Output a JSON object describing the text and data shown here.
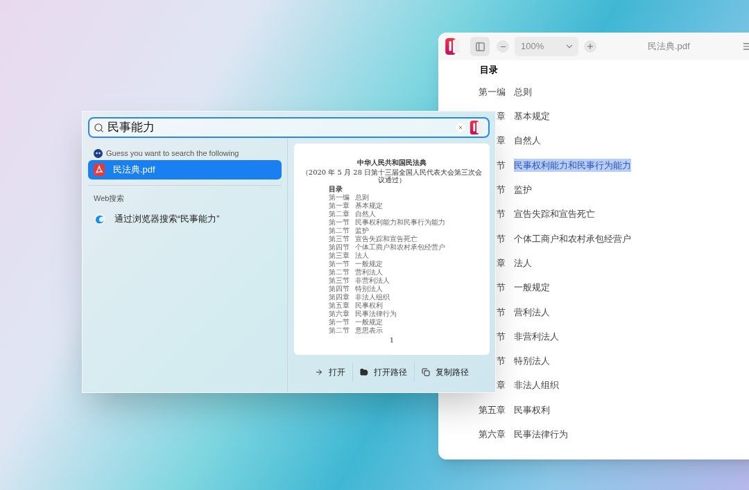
{
  "reader": {
    "title": "民法典.pdf",
    "zoom": "100%",
    "heading": "目录",
    "rows": [
      {
        "label": "第一编",
        "text": "总则",
        "highlighted": false
      },
      {
        "label": "章",
        "text": "基本规定",
        "highlighted": false
      },
      {
        "label": "章",
        "text": "自然人",
        "highlighted": false
      },
      {
        "label": "节",
        "text": "民事权利能力和民事行为能力",
        "highlighted": true
      },
      {
        "label": "节",
        "text": "监护",
        "highlighted": false
      },
      {
        "label": "节",
        "text": "宣告失踪和宣告死亡",
        "highlighted": false
      },
      {
        "label": "节",
        "text": "个体工商户和农村承包经营户",
        "highlighted": false
      },
      {
        "label": "章",
        "text": "法人",
        "highlighted": false
      },
      {
        "label": "节",
        "text": "一般规定",
        "highlighted": false
      },
      {
        "label": "节",
        "text": "营利法人",
        "highlighted": false
      },
      {
        "label": "节",
        "text": "非营利法人",
        "highlighted": false
      },
      {
        "label": "节",
        "text": "特别法人",
        "highlighted": false
      },
      {
        "label": "章",
        "text": "非法人组织",
        "highlighted": false
      },
      {
        "label": "第五章",
        "text": "民事权利",
        "highlighted": false
      },
      {
        "label": "第六章",
        "text": "民事法律行为",
        "highlighted": false
      }
    ]
  },
  "search": {
    "value": "民事能力"
  },
  "suggestion_header": "Guess you want to search the following",
  "results": [
    {
      "kind": "pdf",
      "label": "民法典.pdf",
      "selected": true
    }
  ],
  "web_section": {
    "title": "Web搜索",
    "items": [
      {
        "kind": "browser",
        "label": "通过浏览器搜索“民事能力”",
        "selected": false
      }
    ]
  },
  "preview": {
    "title": "中华人民共和国民法典",
    "subtitle": "（2020 年 5 月 28 日第十三届全国人民代表大会第三次会议通过）",
    "heading": "目录",
    "rows": [
      {
        "label": "第一编",
        "text": "总则"
      },
      {
        "label": "第一章",
        "text": "基本规定"
      },
      {
        "label": "第二章",
        "text": "自然人"
      },
      {
        "label": "第一节",
        "text": "民事权利能力和民事行为能力"
      },
      {
        "label": "第二节",
        "text": "监护"
      },
      {
        "label": "第三节",
        "text": "宣告失踪和宣告死亡"
      },
      {
        "label": "第四节",
        "text": "个体工商户和农村承包经营户"
      },
      {
        "label": "第三章",
        "text": "法人"
      },
      {
        "label": "第一节",
        "text": "一般规定"
      },
      {
        "label": "第二节",
        "text": "营利法人"
      },
      {
        "label": "第三节",
        "text": "非营利法人"
      },
      {
        "label": "第四节",
        "text": "特别法人"
      },
      {
        "label": "第四章",
        "text": "非法人组织"
      },
      {
        "label": "第五章",
        "text": "民事权利"
      },
      {
        "label": "第六章",
        "text": "民事法律行为"
      },
      {
        "label": "第一节",
        "text": "一般规定"
      },
      {
        "label": "第二节",
        "text": "意思表示"
      }
    ],
    "page": "1"
  },
  "actions": [
    {
      "kind": "open",
      "label": "打开"
    },
    {
      "kind": "folder",
      "label": "打开路径"
    },
    {
      "kind": "copy",
      "label": "复制路径"
    }
  ]
}
